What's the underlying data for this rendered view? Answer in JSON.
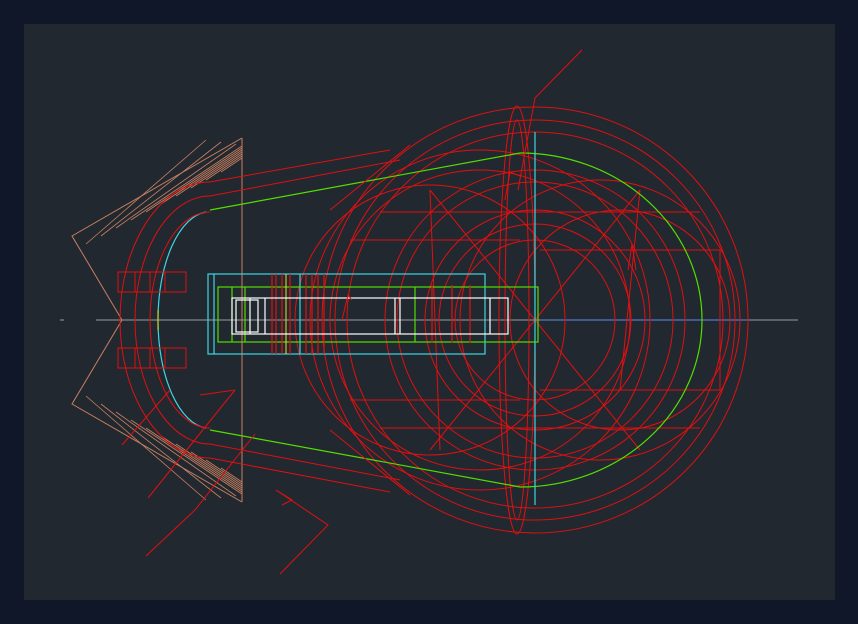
{
  "canvas": {
    "background": "#212830",
    "frame_color": "#0f1729"
  },
  "colors": {
    "red": "#e01010",
    "green": "#55dd00",
    "cyan": "#3fd6e0",
    "white": "#ffffff",
    "tan": "#c88060",
    "yellow": "#e8e020",
    "gray": "#9a9a9a",
    "blue": "#4a6aaa"
  },
  "drawing": {
    "kind": "mechanical CAD drawing",
    "labels": []
  }
}
